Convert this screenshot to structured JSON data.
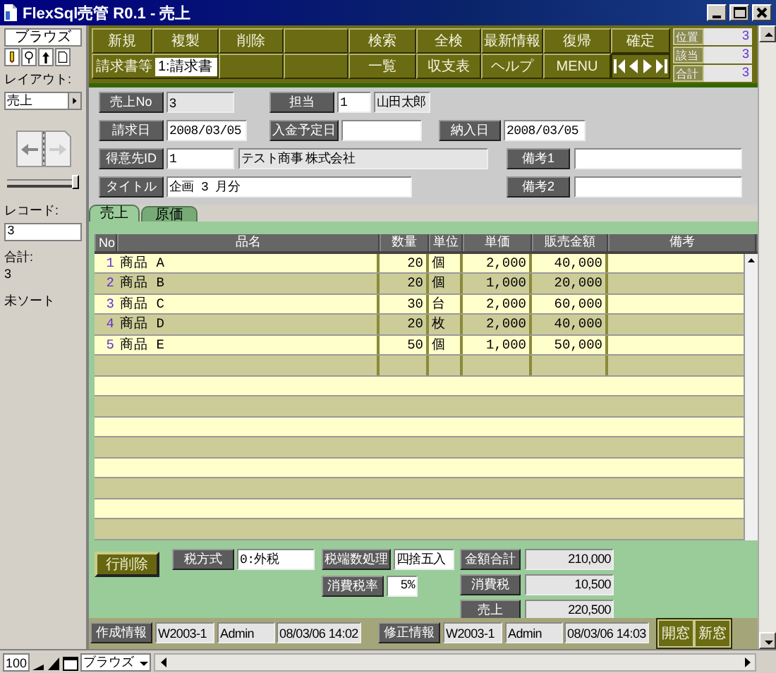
{
  "window": {
    "title": "FlexSql売管 R0.1 - 売上"
  },
  "sidebar": {
    "mode_tab": "ブラウズ",
    "layout_label": "レイアウト:",
    "layout": "売上",
    "record_slider": {
      "level": 1
    },
    "record_label": "レコード:",
    "record": "3",
    "found_label": "合計:",
    "found": "3",
    "sort_status": "未ソート"
  },
  "toolbar": {
    "top_left_buttons": [
      "新規",
      "複製",
      "削除"
    ],
    "top_right_buttons": [
      "検索",
      "全検",
      "最新情報",
      "復帰",
      "確定"
    ],
    "document_type": {
      "label": "請求書等",
      "value": "1:請求書"
    },
    "bottom_buttons": [
      "一覧",
      "収支表",
      "ヘルプ",
      "MENU"
    ],
    "counters": [
      {
        "label": "位置",
        "value": "3"
      },
      {
        "label": "該当",
        "value": "3"
      },
      {
        "label": "合計",
        "value": "3"
      }
    ]
  },
  "record": {
    "sales_no": {
      "label": "売上No",
      "value": "3"
    },
    "staff": {
      "label": "担当",
      "id": "1",
      "name": "山田太郎"
    },
    "invoice_date": {
      "label": "請求日",
      "value": "2008/03/05"
    },
    "payment_due": {
      "label": "入金予定日"
    },
    "delivery_date": {
      "label": "納入日",
      "value": "2008/03/05"
    },
    "customer": {
      "label": "得意先ID",
      "id": "1",
      "name": "テスト商事 株式会社"
    },
    "note_1": {
      "label": "備考1"
    },
    "title": {
      "label": "タイトル",
      "value": "企画 3 月分"
    },
    "note_2": {
      "label": "備考2"
    }
  },
  "tabs": [
    {
      "label": "売上",
      "selected": true
    },
    {
      "label": "原価",
      "selected": false
    }
  ],
  "table": {
    "columns": [
      "No",
      "品名",
      "数量",
      "単位",
      "単価",
      "販売金額",
      "備考"
    ],
    "rows": [
      {
        "no": "1",
        "item": "商品 A",
        "quantity": "20",
        "unit": "個",
        "unit_price": "2,000",
        "amount": "40,000"
      },
      {
        "no": "2",
        "item": "商品 B",
        "quantity": "20",
        "unit": "個",
        "unit_price": "1,000",
        "amount": "20,000"
      },
      {
        "no": "3",
        "item": "商品 C",
        "quantity": "30",
        "unit": "台",
        "unit_price": "2,000",
        "amount": "60,000"
      },
      {
        "no": "4",
        "item": "商品 D",
        "quantity": "20",
        "unit": "枚",
        "unit_price": "2,000",
        "amount": "40,000"
      },
      {
        "no": "5",
        "item": "商品 E",
        "quantity": "50",
        "unit": "個",
        "unit_price": "1,000",
        "amount": "50,000"
      }
    ]
  },
  "summary": {
    "delete_row_button": "行削除",
    "tax_method": {
      "label": "税方式",
      "value": "0:外税"
    },
    "rounding": {
      "label": "税端数処理",
      "value": "四捨五入"
    },
    "tax_rate": {
      "label": "消費税率",
      "value": "5%"
    },
    "totals": [
      {
        "label": "金額合計",
        "value": "210,000"
      },
      {
        "label": "消費税",
        "value": "10,500"
      },
      {
        "label": "売上",
        "value": "220,500"
      }
    ]
  },
  "footer": {
    "created": {
      "label": "作成情報",
      "machine": "W2003-1",
      "user": "Admin",
      "time": "08/03/06 14:02"
    },
    "modified": {
      "label": "修正情報",
      "machine": "W2003-1",
      "user": "Admin",
      "time": "08/03/06 14:03"
    },
    "buttons": [
      "開窓",
      "新窓"
    ]
  },
  "status_bar": {
    "zoom": "100",
    "mode": "ブラウズ"
  }
}
